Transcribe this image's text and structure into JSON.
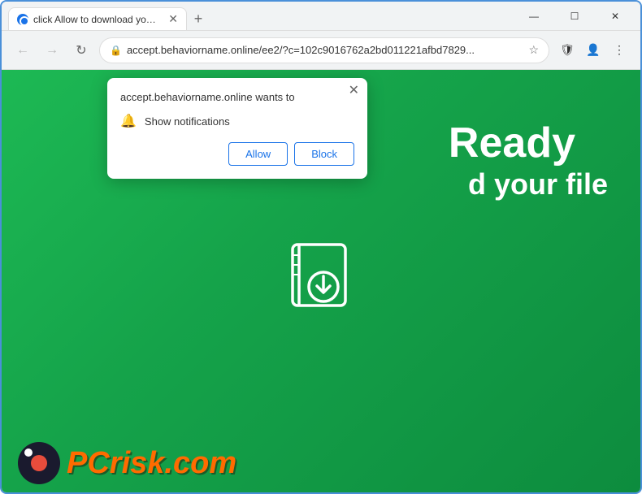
{
  "browser": {
    "tab": {
      "title": "click Allow to download your file",
      "favicon_label": "chrome-favicon"
    },
    "address": {
      "url": "accept.behaviorname.online/ee2/?c=102c9016762a2bd011221afbd7829...",
      "lock_icon": "🔒"
    },
    "window_controls": {
      "minimize": "—",
      "maximize": "☐",
      "close": "✕"
    }
  },
  "popup": {
    "title": "accept.behaviorname.online wants to",
    "close_icon": "✕",
    "notification_row": {
      "icon": "🔔",
      "label": "Show notifications"
    },
    "buttons": {
      "allow": "Allow",
      "block": "Block"
    }
  },
  "page": {
    "text_ready": "Ready",
    "text_file": "d your file",
    "bg_color": "#1db954",
    "accent_color": "#1a73e8"
  },
  "logo": {
    "brand": "PC",
    "suffix": "risk.com"
  },
  "icons": {
    "back": "←",
    "forward": "→",
    "reload": "↻",
    "star": "☆",
    "shield": "🛡",
    "profile": "👤",
    "menu": "⋮",
    "new_tab": "+"
  }
}
